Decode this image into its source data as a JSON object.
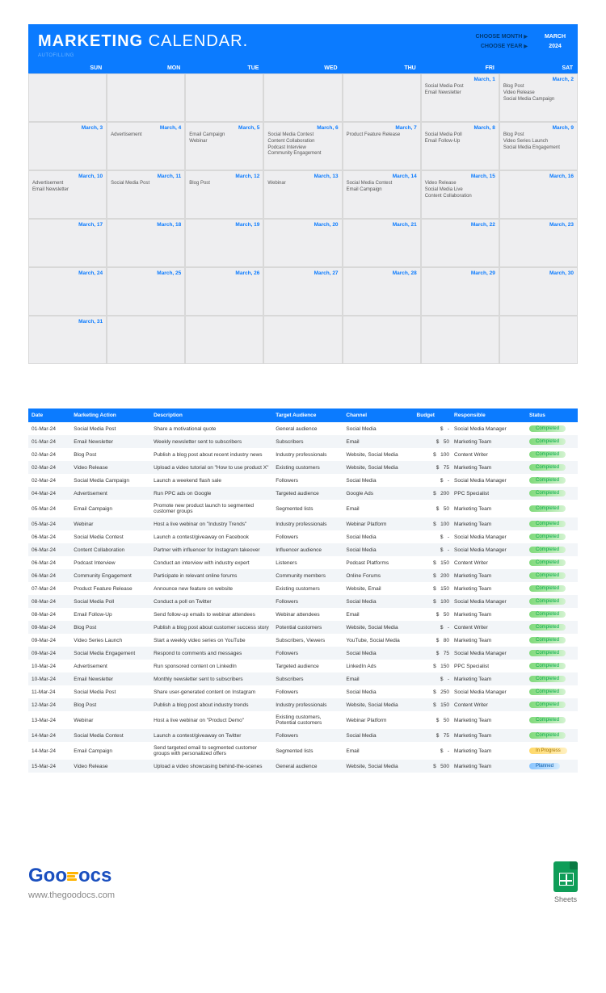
{
  "header": {
    "title_bold": "MARKETING",
    "title_light": "CALENDAR.",
    "autofilling": "AUTOFILLING",
    "choose_month": "CHOOSE MONTH",
    "choose_year": "CHOOSE YEAR",
    "month_val": "MARCH",
    "year_val": "2024"
  },
  "days": [
    "SUN",
    "MON",
    "TUE",
    "WED",
    "THU",
    "FRI",
    "SAT"
  ],
  "cells": [
    {
      "date": "",
      "events": []
    },
    {
      "date": "",
      "events": []
    },
    {
      "date": "",
      "events": []
    },
    {
      "date": "",
      "events": []
    },
    {
      "date": "",
      "events": []
    },
    {
      "date": "March, 1",
      "events": [
        "Social Media Post",
        "Email Newsletter"
      ]
    },
    {
      "date": "March, 2",
      "events": [
        "Blog Post",
        "Video Release",
        "Social Media Campaign"
      ]
    },
    {
      "date": "March, 3",
      "events": []
    },
    {
      "date": "March, 4",
      "events": [
        "Advertisement"
      ]
    },
    {
      "date": "March, 5",
      "events": [
        "Email Campaign",
        "Webinar"
      ]
    },
    {
      "date": "March, 6",
      "events": [
        "Social Media Contest",
        "Content Collaboration",
        "Podcast Interview",
        "Community Engagement"
      ]
    },
    {
      "date": "March, 7",
      "events": [
        "Product Feature Release"
      ]
    },
    {
      "date": "March, 8",
      "events": [
        "Social Media Poll",
        "Email Follow-Up"
      ]
    },
    {
      "date": "March, 9",
      "events": [
        "Blog Post",
        "Video Series Launch",
        "Social Media Engagement"
      ]
    },
    {
      "date": "March, 10",
      "events": [
        "Advertisement",
        "Email Newsletter"
      ]
    },
    {
      "date": "March, 11",
      "events": [
        "Social Media Post"
      ]
    },
    {
      "date": "March, 12",
      "events": [
        "Blog Post"
      ]
    },
    {
      "date": "March, 13",
      "events": [
        "Webinar"
      ]
    },
    {
      "date": "March, 14",
      "events": [
        "Social Media Contest",
        "Email Campaign"
      ]
    },
    {
      "date": "March, 15",
      "events": [
        "Video Release",
        "Social Media Live",
        "Content Collaboration"
      ]
    },
    {
      "date": "March, 16",
      "events": []
    },
    {
      "date": "March, 17",
      "events": []
    },
    {
      "date": "March, 18",
      "events": []
    },
    {
      "date": "March, 19",
      "events": []
    },
    {
      "date": "March, 20",
      "events": []
    },
    {
      "date": "March, 21",
      "events": []
    },
    {
      "date": "March, 22",
      "events": []
    },
    {
      "date": "March, 23",
      "events": []
    },
    {
      "date": "March, 24",
      "events": []
    },
    {
      "date": "March, 25",
      "events": []
    },
    {
      "date": "March, 26",
      "events": []
    },
    {
      "date": "March, 27",
      "events": []
    },
    {
      "date": "March, 28",
      "events": []
    },
    {
      "date": "March, 29",
      "events": []
    },
    {
      "date": "March, 30",
      "events": []
    },
    {
      "date": "March, 31",
      "events": []
    },
    {
      "date": "",
      "events": []
    },
    {
      "date": "",
      "events": []
    },
    {
      "date": "",
      "events": []
    },
    {
      "date": "",
      "events": []
    },
    {
      "date": "",
      "events": []
    },
    {
      "date": "",
      "events": []
    }
  ],
  "table_headers": [
    "Date",
    "Marketing Action",
    "Description",
    "Target Audience",
    "Channel",
    "Budget",
    "Responsible",
    "Status"
  ],
  "rows": [
    {
      "date": "01-Mar-24",
      "action": "Social Media Post",
      "desc": "Share a motivational quote",
      "aud": "General audience",
      "chan": "Social Media",
      "budget": "-",
      "resp": "Social Media Manager",
      "status": "Completed"
    },
    {
      "date": "01-Mar-24",
      "action": "Email Newsletter",
      "desc": "Weekly newsletter sent to subscribers",
      "aud": "Subscribers",
      "chan": "Email",
      "budget": "50",
      "resp": "Marketing Team",
      "status": "Completed"
    },
    {
      "date": "02-Mar-24",
      "action": "Blog Post",
      "desc": "Publish a blog post about recent industry news",
      "aud": "Industry professionals",
      "chan": "Website, Social Media",
      "budget": "100",
      "resp": "Content Writer",
      "status": "Completed"
    },
    {
      "date": "02-Mar-24",
      "action": "Video Release",
      "desc": "Upload a video tutorial on \"How to use product X\"",
      "aud": "Existing customers",
      "chan": "Website, Social Media",
      "budget": "75",
      "resp": "Marketing Team",
      "status": "Completed"
    },
    {
      "date": "02-Mar-24",
      "action": "Social Media Campaign",
      "desc": "Launch a weekend flash sale",
      "aud": "Followers",
      "chan": "Social Media",
      "budget": "-",
      "resp": "Social Media Manager",
      "status": "Completed"
    },
    {
      "date": "04-Mar-24",
      "action": "Advertisement",
      "desc": "Run PPC ads on Google",
      "aud": "Targeted audience",
      "chan": "Google Ads",
      "budget": "200",
      "resp": "PPC Specialist",
      "status": "Completed"
    },
    {
      "date": "05-Mar-24",
      "action": "Email Campaign",
      "desc": "Promote new product launch to segmented customer groups",
      "aud": "Segmented lists",
      "chan": "Email",
      "budget": "50",
      "resp": "Marketing Team",
      "status": "Completed"
    },
    {
      "date": "05-Mar-24",
      "action": "Webinar",
      "desc": "Host a live webinar on \"Industry Trends\"",
      "aud": "Industry professionals",
      "chan": "Webinar Platform",
      "budget": "100",
      "resp": "Marketing Team",
      "status": "Completed"
    },
    {
      "date": "06-Mar-24",
      "action": "Social Media Contest",
      "desc": "Launch a contest/giveaway on Facebook",
      "aud": "Followers",
      "chan": "Social Media",
      "budget": "-",
      "resp": "Social Media Manager",
      "status": "Completed"
    },
    {
      "date": "06-Mar-24",
      "action": "Content Collaboration",
      "desc": "Partner with influencer for Instagram takeover",
      "aud": "Influencer audience",
      "chan": "Social Media",
      "budget": "-",
      "resp": "Social Media Manager",
      "status": "Completed"
    },
    {
      "date": "06-Mar-24",
      "action": "Podcast Interview",
      "desc": "Conduct an interview with industry expert",
      "aud": "Listeners",
      "chan": "Podcast Platforms",
      "budget": "150",
      "resp": "Content Writer",
      "status": "Completed"
    },
    {
      "date": "06-Mar-24",
      "action": "Community Engagement",
      "desc": "Participate in relevant online forums",
      "aud": "Community members",
      "chan": "Online Forums",
      "budget": "200",
      "resp": "Marketing Team",
      "status": "Completed"
    },
    {
      "date": "07-Mar-24",
      "action": "Product Feature Release",
      "desc": "Announce new feature on website",
      "aud": "Existing customers",
      "chan": "Website, Email",
      "budget": "150",
      "resp": "Marketing Team",
      "status": "Completed"
    },
    {
      "date": "08-Mar-24",
      "action": "Social Media Poll",
      "desc": "Conduct a poll on Twitter",
      "aud": "Followers",
      "chan": "Social Media",
      "budget": "100",
      "resp": "Social Media Manager",
      "status": "Completed"
    },
    {
      "date": "08-Mar-24",
      "action": "Email Follow-Up",
      "desc": "Send follow-up emails to webinar attendees",
      "aud": "Webinar attendees",
      "chan": "Email",
      "budget": "50",
      "resp": "Marketing Team",
      "status": "Completed"
    },
    {
      "date": "09-Mar-24",
      "action": "Blog Post",
      "desc": "Publish a blog post about customer success story",
      "aud": "Potential customers",
      "chan": "Website, Social Media",
      "budget": "-",
      "resp": "Content Writer",
      "status": "Completed"
    },
    {
      "date": "09-Mar-24",
      "action": "Video Series Launch",
      "desc": "Start a weekly video series on YouTube",
      "aud": "Subscribers, Viewers",
      "chan": "YouTube, Social Media",
      "budget": "80",
      "resp": "Marketing Team",
      "status": "Completed"
    },
    {
      "date": "09-Mar-24",
      "action": "Social Media Engagement",
      "desc": "Respond to comments and messages",
      "aud": "Followers",
      "chan": "Social Media",
      "budget": "75",
      "resp": "Social Media Manager",
      "status": "Completed"
    },
    {
      "date": "10-Mar-24",
      "action": "Advertisement",
      "desc": "Run sponsored content on LinkedIn",
      "aud": "Targeted audience",
      "chan": "LinkedIn Ads",
      "budget": "150",
      "resp": "PPC Specialist",
      "status": "Completed"
    },
    {
      "date": "10-Mar-24",
      "action": "Email Newsletter",
      "desc": "Monthly newsletter sent to subscribers",
      "aud": "Subscribers",
      "chan": "Email",
      "budget": "-",
      "resp": "Marketing Team",
      "status": "Completed"
    },
    {
      "date": "11-Mar-24",
      "action": "Social Media Post",
      "desc": "Share user-generated content on Instagram",
      "aud": "Followers",
      "chan": "Social Media",
      "budget": "250",
      "resp": "Social Media Manager",
      "status": "Completed"
    },
    {
      "date": "12-Mar-24",
      "action": "Blog Post",
      "desc": "Publish a blog post about industry trends",
      "aud": "Industry professionals",
      "chan": "Website, Social Media",
      "budget": "150",
      "resp": "Content Writer",
      "status": "Completed"
    },
    {
      "date": "13-Mar-24",
      "action": "Webinar",
      "desc": "Host a live webinar on \"Product Demo\"",
      "aud": "Existing customers, Potential customers",
      "chan": "Webinar Platform",
      "budget": "50",
      "resp": "Marketing Team",
      "status": "Completed"
    },
    {
      "date": "14-Mar-24",
      "action": "Social Media Contest",
      "desc": "Launch a contest/giveaway on Twitter",
      "aud": "Followers",
      "chan": "Social Media",
      "budget": "75",
      "resp": "Marketing Team",
      "status": "Completed"
    },
    {
      "date": "14-Mar-24",
      "action": "Email Campaign",
      "desc": "Send targeted email to segmented customer groups with personalized offers",
      "aud": "Segmented lists",
      "chan": "Email",
      "budget": "-",
      "resp": "Marketing Team",
      "status": "In Progress"
    },
    {
      "date": "15-Mar-24",
      "action": "Video Release",
      "desc": "Upload a video showcasing behind-the-scenes",
      "aud": "General audience",
      "chan": "Website, Social Media",
      "budget": "500",
      "resp": "Marketing Team",
      "status": "Planned"
    }
  ],
  "footer": {
    "brand": "GooDocs",
    "url": "www.thegoodocs.com",
    "sheets": "Sheets"
  }
}
